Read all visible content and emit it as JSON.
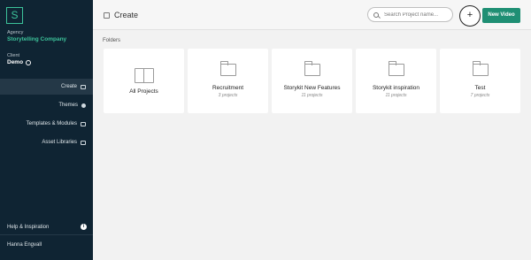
{
  "sidebar": {
    "logo_letter": "S",
    "agency_label": "Agency",
    "agency_name": "Storytelling Company",
    "client_label": "Client",
    "client_name": "Demo",
    "nav": [
      {
        "label": "Create",
        "icon": "create-icon",
        "active": true
      },
      {
        "label": "Themes",
        "icon": "palette-icon",
        "active": false
      },
      {
        "label": "Templates & Modules",
        "icon": "template-icon",
        "active": false
      },
      {
        "label": "Asset Libraries",
        "icon": "library-icon",
        "active": false
      }
    ],
    "help_label": "Help & Inspiration",
    "help_icon_text": "i",
    "user_name": "Hanna Engvall"
  },
  "topbar": {
    "title": "Create",
    "search_placeholder": "Search Project name...",
    "add_label": "+",
    "new_video_label": "New Video"
  },
  "folders_label": "Folders",
  "folders": [
    {
      "name": "All Projects",
      "count": ""
    },
    {
      "name": "Recruitment",
      "count": "3 projects"
    },
    {
      "name": "Storykit New Features",
      "count": "11 projects"
    },
    {
      "name": "Storykit inspiration",
      "count": "11 projects"
    },
    {
      "name": "Test",
      "count": "7 projects"
    }
  ],
  "colors": {
    "sidebar_bg": "#0f2433",
    "accent": "#3cc29a",
    "button": "#1f8f74"
  }
}
